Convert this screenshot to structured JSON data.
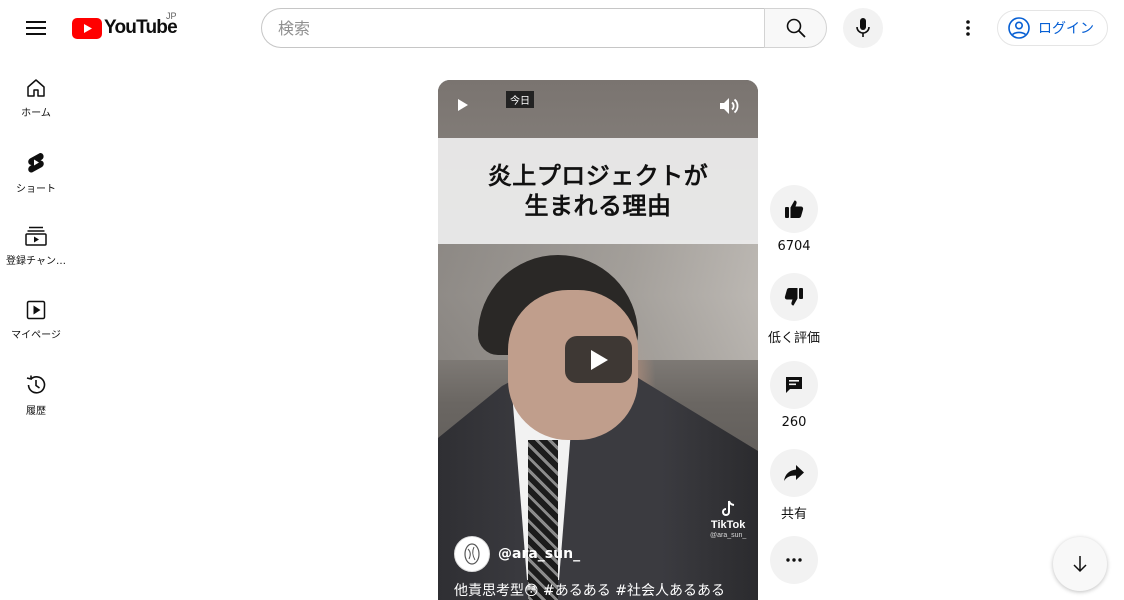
{
  "header": {
    "logo_text": "YouTube",
    "region": "JP",
    "search_placeholder": "検索",
    "login_label": "ログイン"
  },
  "sidebar": {
    "items": [
      {
        "label": "ホーム",
        "icon": "home-icon"
      },
      {
        "label": "ショート",
        "icon": "shorts-icon"
      },
      {
        "label": "登録チャン…",
        "icon": "subscriptions-icon"
      },
      {
        "label": "マイページ",
        "icon": "library-icon"
      },
      {
        "label": "履歴",
        "icon": "history-icon"
      }
    ]
  },
  "video": {
    "date_badge": "今日",
    "caption_line1": "炎上プロジェクトが",
    "caption_line2": "生まれる理由",
    "watermark_name": "TikTok",
    "watermark_handle": "@ara_sun_",
    "channel_name": "@ara_sun_",
    "description": "他責思考型😳 #あるある #社会人あるある"
  },
  "actions": {
    "like_count": "6704",
    "dislike_label": "低く評価",
    "comment_count": "260",
    "share_label": "共有"
  },
  "colors": {
    "brand_red": "#ff0000",
    "link_blue": "#065fd4"
  }
}
